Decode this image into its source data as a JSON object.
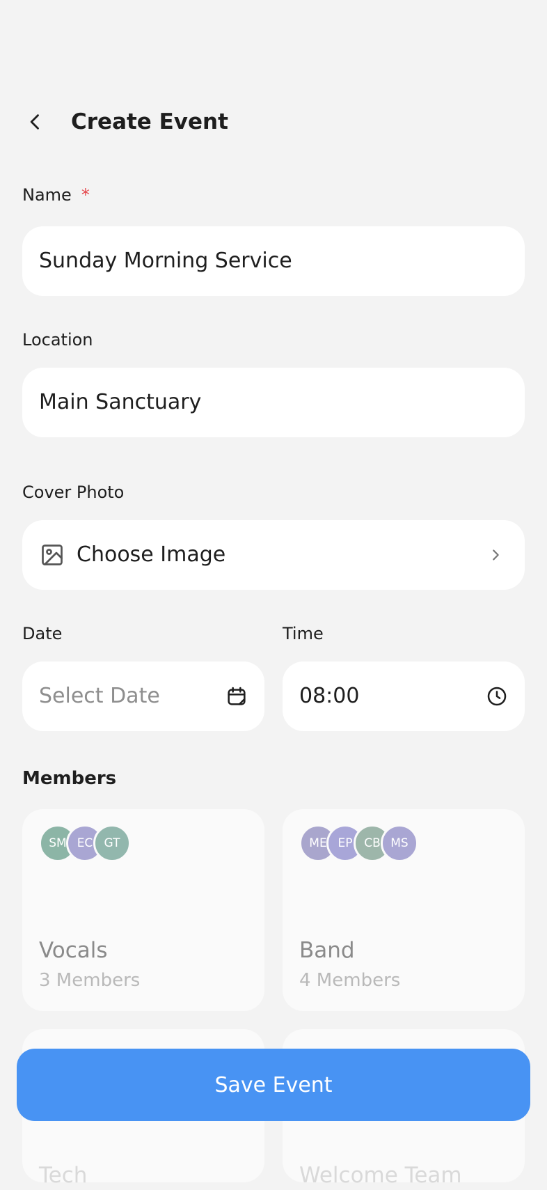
{
  "header": {
    "title": "Create Event"
  },
  "form": {
    "name": {
      "label": "Name",
      "required_mark": "*",
      "value": "Sunday Morning Service"
    },
    "location": {
      "label": "Location",
      "value": "Main Sanctuary"
    },
    "cover_photo": {
      "label": "Cover Photo",
      "button_label": "Choose Image"
    },
    "date": {
      "label": "Date",
      "placeholder": "Select Date"
    },
    "time": {
      "label": "Time",
      "value": "08:00"
    }
  },
  "members": {
    "title": "Members",
    "teams": [
      {
        "name": "Vocals",
        "count_label": "3 Members",
        "avatars": [
          {
            "initials": "SM",
            "color": "#8cb5a6"
          },
          {
            "initials": "EC",
            "color": "#a9a6d3"
          },
          {
            "initials": "GT",
            "color": "#92b7ad"
          }
        ]
      },
      {
        "name": "Band",
        "count_label": "4 Members",
        "avatars": [
          {
            "initials": "ME",
            "color": "#a9a6cd"
          },
          {
            "initials": "EP",
            "color": "#a8a6d8"
          },
          {
            "initials": "CB",
            "color": "#9db6aa"
          },
          {
            "initials": "MS",
            "color": "#a9a6d3"
          }
        ]
      },
      {
        "name": "Tech"
      },
      {
        "name": "Welcome Team"
      }
    ]
  },
  "actions": {
    "save_label": "Save Event"
  },
  "colors": {
    "background": "#f3f3f3",
    "primary": "#4893f3",
    "required": "#e5484d"
  }
}
